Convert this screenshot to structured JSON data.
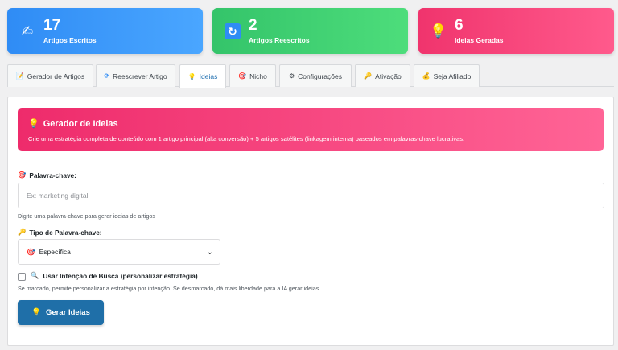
{
  "stats": [
    {
      "value": "17",
      "label": "Artigos Escritos",
      "icon": "writing-hand-icon"
    },
    {
      "value": "2",
      "label": "Artigos Reescritos",
      "icon": "refresh-icon"
    },
    {
      "value": "6",
      "label": "Ideias Geradas",
      "icon": "lightbulb-icon"
    }
  ],
  "tabs": [
    {
      "label": "Gerador de Artigos",
      "icon": "memo-icon"
    },
    {
      "label": "Reescrever Artigo",
      "icon": "refresh-icon"
    },
    {
      "label": "Ideias",
      "icon": "lightbulb-icon",
      "active": true
    },
    {
      "label": "Nicho",
      "icon": "target-icon"
    },
    {
      "label": "Configurações",
      "icon": "gear-icon"
    },
    {
      "label": "Ativação",
      "icon": "key-icon"
    },
    {
      "label": "Seja Afiliado",
      "icon": "money-bag-icon"
    }
  ],
  "hero": {
    "title": "Gerador de Ideias",
    "description": "Crie uma estratégia completa de conteúdo com 1 artigo principal (alta conversão) + 5 artigos satélites (linkagem interna) baseados em palavras-chave lucrativas."
  },
  "keyword": {
    "label": "Palavra-chave:",
    "placeholder": "Ex: marketing digital",
    "value": "",
    "help": "Digite uma palavra-chave para gerar ideias de artigos"
  },
  "keyword_type": {
    "label": "Tipo de Palavra-chave:",
    "selected": "Específica"
  },
  "search_intent": {
    "label": "Usar Intenção de Busca (personalizar estratégia)",
    "checked": false,
    "help": "Se marcado, permite personalizar a estratégia por intenção. Se desmarcado, dá mais liberdade para a IA gerar ideias."
  },
  "submit": {
    "label": "Gerar Ideias"
  },
  "colors": {
    "blue_card": "#2f8cf5",
    "green_card": "#34c46a",
    "pink_card": "#f0346d",
    "active_tab": "#2271b1",
    "button": "#1f6fa8"
  }
}
